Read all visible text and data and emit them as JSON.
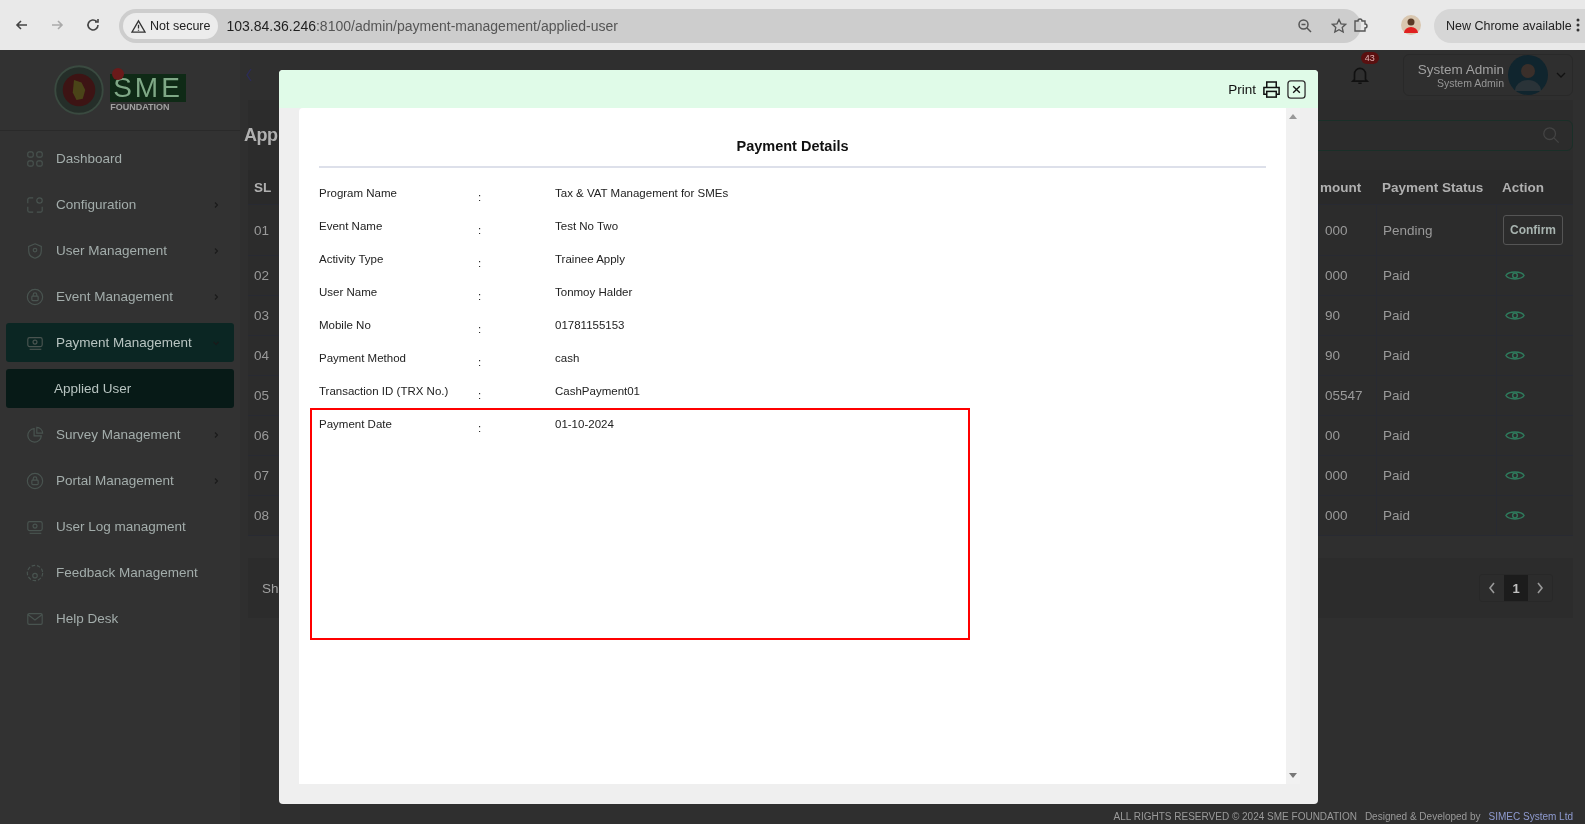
{
  "browser": {
    "security_label": "Not secure",
    "url_host": "103.84.36.246",
    "url_rest": ":8100/admin/payment-management/applied-user",
    "update_label": "New Chrome available"
  },
  "logo": {
    "wordmark": "SME",
    "tagline": "FOUNDATION"
  },
  "sidebar": {
    "items": [
      {
        "label": "Dashboard",
        "selected": false
      },
      {
        "label": "Configuration",
        "selected": false,
        "expanded": false
      },
      {
        "label": "User Management",
        "selected": false,
        "expanded": false
      },
      {
        "label": "Event Management",
        "selected": false,
        "expanded": false
      },
      {
        "label": "Payment Management",
        "selected": true,
        "expanded": true,
        "children": [
          {
            "label": "Applied User",
            "selected": true
          }
        ]
      },
      {
        "label": "Survey Management",
        "selected": false,
        "expanded": false
      },
      {
        "label": "Portal Management",
        "selected": false,
        "expanded": false
      },
      {
        "label": "User Log managment",
        "selected": false
      },
      {
        "label": "Feedback Management",
        "selected": false
      },
      {
        "label": "Help Desk",
        "selected": false
      }
    ]
  },
  "header": {
    "notification_count": "43",
    "user": {
      "name": "System Admin",
      "role": "System Admin"
    }
  },
  "page": {
    "title": "App",
    "table": {
      "columns": [
        "SL",
        "mount",
        "Payment Status",
        "Action"
      ],
      "rows": [
        {
          "sl": "01",
          "amount": "000",
          "status": "Pending",
          "action": {
            "kind": "button",
            "label": "Confirm"
          }
        },
        {
          "sl": "02",
          "amount": "000",
          "status": "Paid",
          "action": {
            "kind": "view"
          }
        },
        {
          "sl": "03",
          "amount": "90",
          "status": "Paid",
          "action": {
            "kind": "view"
          }
        },
        {
          "sl": "04",
          "amount": "90",
          "status": "Paid",
          "action": {
            "kind": "view"
          }
        },
        {
          "sl": "05",
          "amount": "05547",
          "status": "Paid",
          "action": {
            "kind": "view"
          }
        },
        {
          "sl": "06",
          "amount": "00",
          "status": "Paid",
          "action": {
            "kind": "view"
          }
        },
        {
          "sl": "07",
          "amount": "000",
          "status": "Paid",
          "action": {
            "kind": "view"
          }
        },
        {
          "sl": "08",
          "amount": "000",
          "status": "Paid",
          "action": {
            "kind": "view"
          }
        }
      ]
    },
    "entries_text": "Sh",
    "pagination": [
      {
        "label": "1",
        "selected": true
      }
    ]
  },
  "footer": {
    "copyright": "ALL RIGHTS RESERVED © 2024 SME FOUNDATION",
    "credit_prefix": "Designed & Developed by",
    "credit_link": "SIMEC System Ltd"
  },
  "modal": {
    "print_label": "Print",
    "title": "Payment Details",
    "fields": [
      {
        "label": "Program Name",
        "separator": ":",
        "value": "Tax & VAT Management for SMEs"
      },
      {
        "label": "Event Name",
        "separator": ":",
        "value": "Test No Two"
      },
      {
        "label": "Activity Type",
        "separator": ":",
        "value": "Trainee Apply"
      },
      {
        "label": "User Name",
        "separator": ":",
        "value": "Tonmoy Halder"
      },
      {
        "label": "Mobile No",
        "separator": ":",
        "value": "01781155153"
      },
      {
        "label": "Payment Method",
        "separator": ":",
        "value": "cash"
      },
      {
        "label": "Transaction ID (TRX No.)",
        "separator": ":",
        "value": "CashPayment01"
      },
      {
        "label": "Payment Date",
        "separator": ":",
        "value": "01-10-2024"
      }
    ]
  }
}
